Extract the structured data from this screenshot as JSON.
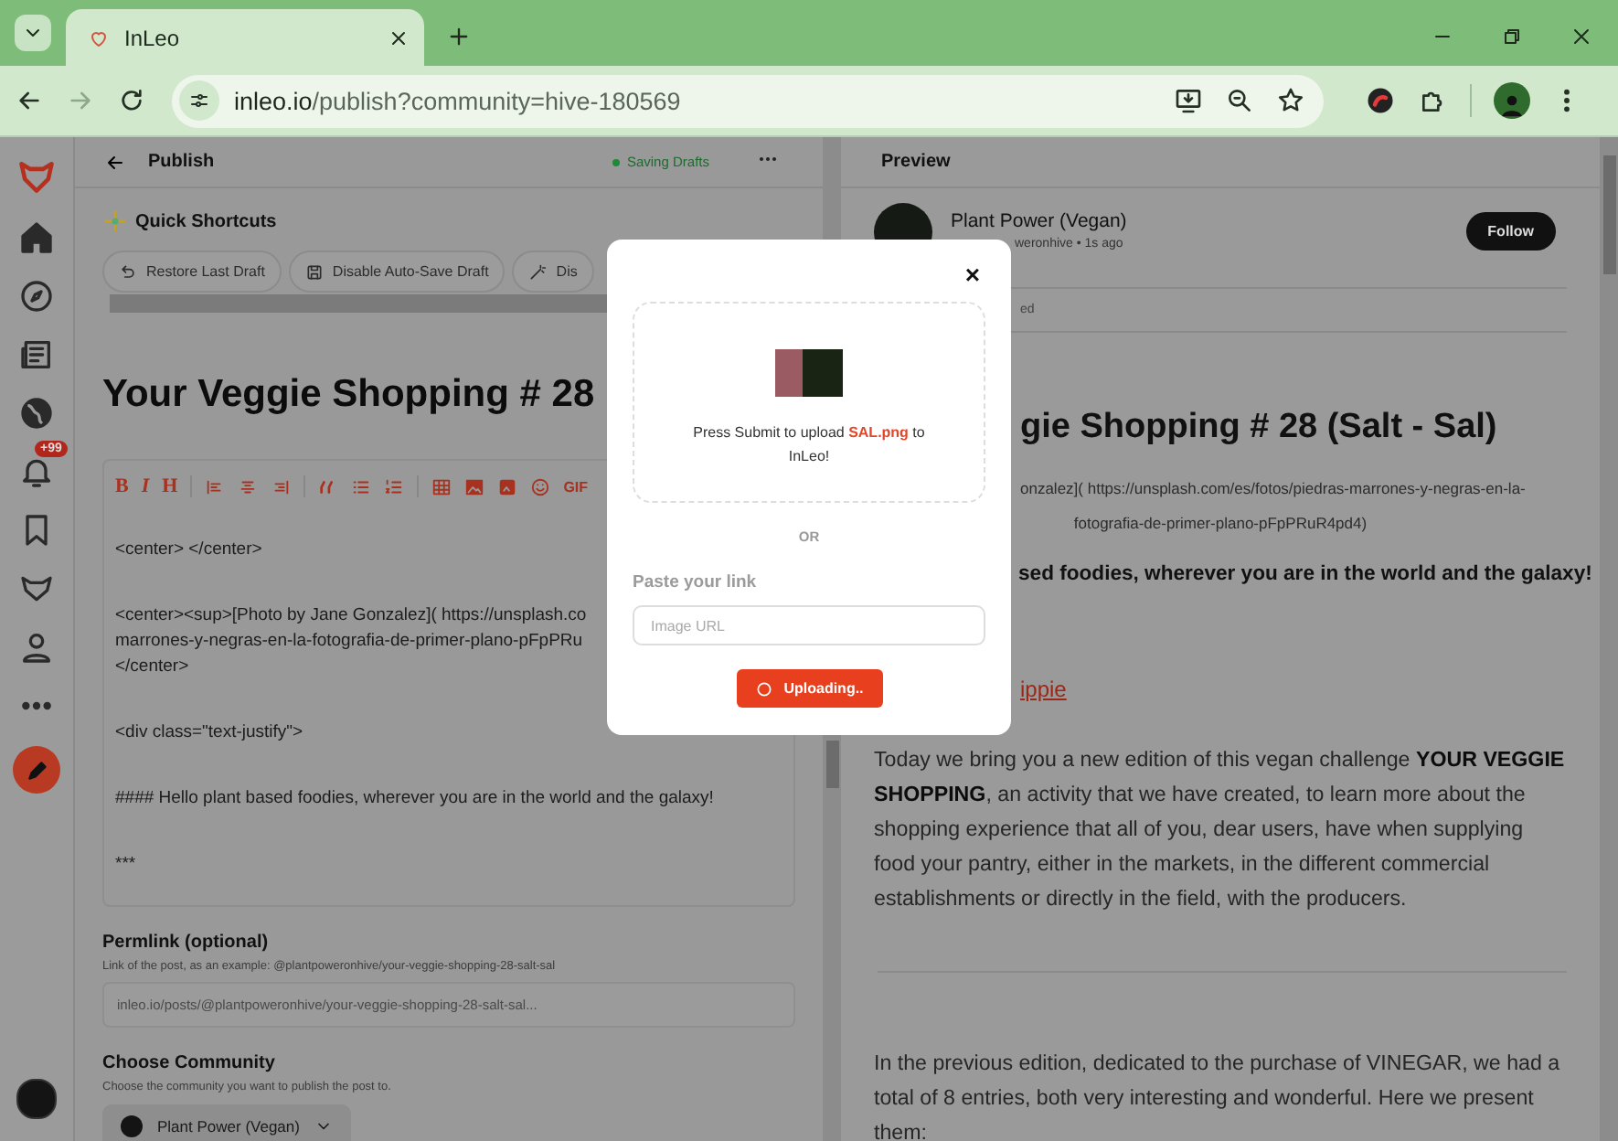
{
  "browser": {
    "tab": {
      "title": "InLeo"
    },
    "url": {
      "host": "inleo.io",
      "path": "/publish?community=hive-180569"
    }
  },
  "sidebar": {
    "notification_badge": "+99"
  },
  "editor": {
    "title": "Publish",
    "status": "Saving Drafts",
    "shortcuts_title": "Quick Shortcuts",
    "shortcuts": [
      "Restore Last Draft",
      "Disable Auto-Save Draft",
      "Dis"
    ],
    "post_title": "Your Veggie Shopping # 28",
    "toolbar": {
      "bold": "B",
      "italic": "I",
      "heading": "H",
      "gif": "GIF"
    },
    "body": [
      [
        "<center> </center>"
      ],
      [
        "<center><sup>[Photo by Jane Gonzalez]( https://unsplash.co",
        "marrones-y-negras-en-la-fotografia-de-primer-plano-pFpPRu",
        "</center>"
      ],
      [
        "<div class=\"text-justify\">"
      ],
      [
        "#### Hello plant based foodies, wherever you are in the world and the galaxy!"
      ],
      [
        "***"
      ]
    ],
    "permlink": {
      "label": "Permlink (optional)",
      "hint": "Link of the post, as an example: @plantpoweronhive/your-veggie-shopping-28-salt-sal",
      "placeholder": "inleo.io/posts/@plantpoweronhive/your-veggie-shopping-28-salt-sal..."
    },
    "community": {
      "label": "Choose Community",
      "hint": "Choose the community you want to publish the post to.",
      "value": "Plant Power (Vegan)"
    }
  },
  "preview": {
    "title": "Preview",
    "author": "Plant Power (Vegan)",
    "meta": "weronhive • 1s ago",
    "follow": "Follow",
    "tag_fragment": "ed",
    "post_title": "gie Shopping # 28 (Salt - Sal)",
    "credit": [
      "onzalez]( https://unsplash.com/es/fotos/piedras-marrones-y-negras-en-la-",
      "fotografia-de-primer-plano-pFpPRuR4pd4)"
    ],
    "greeting": "sed foodies, wherever you are in the world and the galaxy!",
    "link": "ippie",
    "paragraphs": [
      "Today we bring you a new edition of this vegan challenge **YOUR VEGGIE SHOPPING**, an activity that we have created, to learn more about the shopping experience that all of you, dear users, have when supplying food your pantry, either in the markets, in the different commercial establishments or directly in the field, with the producers.",
      "In the previous edition, dedicated to the purchase of VINEGAR, we had a total of 8 entries, both very interesting and wonderful. Here we present them:"
    ]
  },
  "modal": {
    "close": "×",
    "upload_text": "Press Submit to upload **SAL.png** to InLeo!",
    "divider": "OR",
    "link_label": "Paste your link",
    "link_placeholder": "Image URL",
    "button": "Uploading.."
  }
}
